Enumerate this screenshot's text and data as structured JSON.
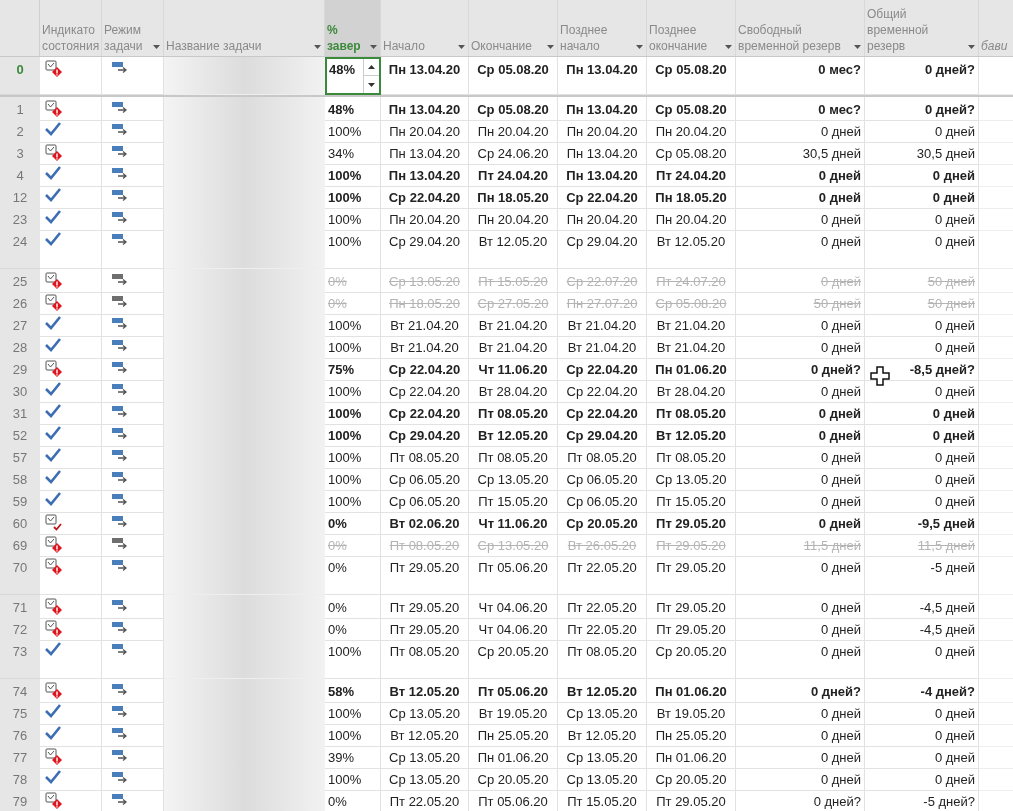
{
  "columns": [
    {
      "lines": [
        "Индикато",
        "состояния"
      ],
      "filter": false,
      "selected": false,
      "italic": false
    },
    {
      "lines": [
        "Режим",
        "задачи"
      ],
      "filter": true,
      "selected": false,
      "italic": false
    },
    {
      "lines": [
        "Название задачи"
      ],
      "filter": true,
      "selected": false,
      "italic": false
    },
    {
      "lines": [
        "%",
        "завер"
      ],
      "filter": true,
      "selected": true,
      "italic": false
    },
    {
      "lines": [
        "Начало"
      ],
      "filter": true,
      "selected": false,
      "italic": false
    },
    {
      "lines": [
        "Окончание"
      ],
      "filter": true,
      "selected": false,
      "italic": false
    },
    {
      "lines": [
        "Позднее",
        "начало"
      ],
      "filter": true,
      "selected": false,
      "italic": false
    },
    {
      "lines": [
        "Позднее",
        "окончание"
      ],
      "filter": true,
      "selected": false,
      "italic": false
    },
    {
      "lines": [
        "Свободный",
        "временной резерв"
      ],
      "filter": true,
      "selected": false,
      "italic": false
    },
    {
      "lines": [
        "Общий",
        "временной",
        "резерв"
      ],
      "filter": true,
      "selected": false,
      "italic": false
    },
    {
      "lines": [
        "бави"
      ],
      "filter": false,
      "selected": false,
      "italic": true
    }
  ],
  "rows": [
    {
      "id": "0",
      "kind": "alert",
      "bold": true,
      "inactive": false,
      "tall": true,
      "selected": true,
      "values": [
        "48%",
        "Пн 13.04.20",
        "Ср 05.08.20",
        "Пн 13.04.20",
        "Ср 05.08.20",
        "0 мес?",
        "0 дней?"
      ]
    },
    {
      "id": "1",
      "kind": "alert",
      "bold": true,
      "inactive": false,
      "tall": false,
      "selected": false,
      "values": [
        "48%",
        "Пн 13.04.20",
        "Ср 05.08.20",
        "Пн 13.04.20",
        "Ср 05.08.20",
        "0 мес?",
        "0 дней?"
      ]
    },
    {
      "id": "2",
      "kind": "done",
      "bold": false,
      "inactive": false,
      "tall": false,
      "selected": false,
      "values": [
        "100%",
        "Пн 20.04.20",
        "Пн 20.04.20",
        "Пн 20.04.20",
        "Пн 20.04.20",
        "0 дней",
        "0 дней"
      ]
    },
    {
      "id": "3",
      "kind": "alert",
      "bold": false,
      "inactive": false,
      "tall": false,
      "selected": false,
      "values": [
        "34%",
        "Пн 13.04.20",
        "Ср 24.06.20",
        "Пн 13.04.20",
        "Ср 05.08.20",
        "30,5 дней",
        "30,5 дней"
      ]
    },
    {
      "id": "4",
      "kind": "done",
      "bold": true,
      "inactive": false,
      "tall": false,
      "selected": false,
      "values": [
        "100%",
        "Пн 13.04.20",
        "Пт 24.04.20",
        "Пн 13.04.20",
        "Пт 24.04.20",
        "0 дней",
        "0 дней"
      ]
    },
    {
      "id": "12",
      "kind": "done",
      "bold": true,
      "inactive": false,
      "tall": false,
      "selected": false,
      "values": [
        "100%",
        "Ср 22.04.20",
        "Пн 18.05.20",
        "Ср 22.04.20",
        "Пн 18.05.20",
        "0 дней",
        "0 дней"
      ]
    },
    {
      "id": "23",
      "kind": "done",
      "bold": false,
      "inactive": false,
      "tall": false,
      "selected": false,
      "values": [
        "100%",
        "Пн 20.04.20",
        "Пн 20.04.20",
        "Пн 20.04.20",
        "Пн 20.04.20",
        "0 дней",
        "0 дней"
      ]
    },
    {
      "id": "24",
      "kind": "done",
      "bold": false,
      "inactive": false,
      "tall": true,
      "selected": false,
      "values": [
        "100%",
        "Ср 29.04.20",
        "Вт 12.05.20",
        "Ср 29.04.20",
        "Вт 12.05.20",
        "0 дней",
        "0 дней"
      ]
    },
    {
      "id": "25",
      "kind": "alert",
      "bold": false,
      "inactive": true,
      "tall": false,
      "selected": false,
      "values": [
        "0%",
        "Ср 13.05.20",
        "Пт 15.05.20",
        "Ср 22.07.20",
        "Пт 24.07.20",
        "0 дней",
        "50 дней"
      ]
    },
    {
      "id": "26",
      "kind": "alert",
      "bold": false,
      "inactive": true,
      "tall": false,
      "selected": false,
      "values": [
        "0%",
        "Пн 18.05.20",
        "Ср 27.05.20",
        "Пн 27.07.20",
        "Ср 05.08.20",
        "50 дней",
        "50 дней"
      ]
    },
    {
      "id": "27",
      "kind": "done",
      "bold": false,
      "inactive": false,
      "tall": false,
      "selected": false,
      "values": [
        "100%",
        "Вт 21.04.20",
        "Вт 21.04.20",
        "Вт 21.04.20",
        "Вт 21.04.20",
        "0 дней",
        "0 дней"
      ]
    },
    {
      "id": "28",
      "kind": "done",
      "bold": false,
      "inactive": false,
      "tall": false,
      "selected": false,
      "values": [
        "100%",
        "Вт 21.04.20",
        "Вт 21.04.20",
        "Вт 21.04.20",
        "Вт 21.04.20",
        "0 дней",
        "0 дней"
      ]
    },
    {
      "id": "29",
      "kind": "alert",
      "bold": true,
      "inactive": false,
      "tall": false,
      "selected": false,
      "values": [
        "75%",
        "Ср 22.04.20",
        "Чт 11.06.20",
        "Ср 22.04.20",
        "Пн 01.06.20",
        "0 дней?",
        "-8,5 дней?"
      ]
    },
    {
      "id": "30",
      "kind": "done",
      "bold": false,
      "inactive": false,
      "tall": false,
      "selected": false,
      "values": [
        "100%",
        "Ср 22.04.20",
        "Вт 28.04.20",
        "Ср 22.04.20",
        "Вт 28.04.20",
        "0 дней",
        "0 дней"
      ]
    },
    {
      "id": "31",
      "kind": "done",
      "bold": true,
      "inactive": false,
      "tall": false,
      "selected": false,
      "values": [
        "100%",
        "Ср 22.04.20",
        "Пт 08.05.20",
        "Ср 22.04.20",
        "Пт 08.05.20",
        "0 дней",
        "0 дней"
      ]
    },
    {
      "id": "52",
      "kind": "done",
      "bold": true,
      "inactive": false,
      "tall": false,
      "selected": false,
      "values": [
        "100%",
        "Ср 29.04.20",
        "Вт 12.05.20",
        "Ср 29.04.20",
        "Вт 12.05.20",
        "0 дней",
        "0 дней"
      ]
    },
    {
      "id": "57",
      "kind": "done",
      "bold": false,
      "inactive": false,
      "tall": false,
      "selected": false,
      "values": [
        "100%",
        "Пт 08.05.20",
        "Пт 08.05.20",
        "Пт 08.05.20",
        "Пт 08.05.20",
        "0 дней",
        "0 дней"
      ]
    },
    {
      "id": "58",
      "kind": "done",
      "bold": false,
      "inactive": false,
      "tall": false,
      "selected": false,
      "values": [
        "100%",
        "Ср 06.05.20",
        "Ср 13.05.20",
        "Ср 06.05.20",
        "Ср 13.05.20",
        "0 дней",
        "0 дней"
      ]
    },
    {
      "id": "59",
      "kind": "done",
      "bold": false,
      "inactive": false,
      "tall": false,
      "selected": false,
      "values": [
        "100%",
        "Ср 06.05.20",
        "Пт 15.05.20",
        "Ср 06.05.20",
        "Пт 15.05.20",
        "0 дней",
        "0 дней"
      ]
    },
    {
      "id": "60",
      "kind": "ontime",
      "bold": true,
      "inactive": false,
      "tall": false,
      "selected": false,
      "values": [
        "0%",
        "Вт 02.06.20",
        "Чт 11.06.20",
        "Ср 20.05.20",
        "Пт 29.05.20",
        "0 дней",
        "-9,5 дней"
      ]
    },
    {
      "id": "69",
      "kind": "alert",
      "bold": false,
      "inactive": true,
      "tall": false,
      "selected": false,
      "values": [
        "0%",
        "Пт 08.05.20",
        "Ср 13.05.20",
        "Вт 26.05.20",
        "Пт 29.05.20",
        "11,5 дней",
        "11,5 дней"
      ]
    },
    {
      "id": "70",
      "kind": "alert",
      "bold": false,
      "inactive": false,
      "tall": true,
      "selected": false,
      "values": [
        "0%",
        "Пт 29.05.20",
        "Пт 05.06.20",
        "Пт 22.05.20",
        "Пт 29.05.20",
        "0 дней",
        "-5 дней"
      ]
    },
    {
      "id": "71",
      "kind": "alert",
      "bold": false,
      "inactive": false,
      "tall": false,
      "selected": false,
      "values": [
        "0%",
        "Пт 29.05.20",
        "Чт 04.06.20",
        "Пт 22.05.20",
        "Пт 29.05.20",
        "0 дней",
        "-4,5 дней"
      ]
    },
    {
      "id": "72",
      "kind": "alert",
      "bold": false,
      "inactive": false,
      "tall": false,
      "selected": false,
      "values": [
        "0%",
        "Пт 29.05.20",
        "Чт 04.06.20",
        "Пт 22.05.20",
        "Пт 29.05.20",
        "0 дней",
        "-4,5 дней"
      ]
    },
    {
      "id": "73",
      "kind": "done",
      "bold": false,
      "inactive": false,
      "tall": true,
      "selected": false,
      "values": [
        "100%",
        "Пт 08.05.20",
        "Ср 20.05.20",
        "Пт 08.05.20",
        "Ср 20.05.20",
        "0 дней",
        "0 дней"
      ]
    },
    {
      "id": "74",
      "kind": "alert",
      "bold": true,
      "inactive": false,
      "tall": false,
      "selected": false,
      "values": [
        "58%",
        "Вт 12.05.20",
        "Пт 05.06.20",
        "Вт 12.05.20",
        "Пн 01.06.20",
        "0 дней?",
        "-4 дней?"
      ]
    },
    {
      "id": "75",
      "kind": "done",
      "bold": false,
      "inactive": false,
      "tall": false,
      "selected": false,
      "values": [
        "100%",
        "Ср 13.05.20",
        "Вт 19.05.20",
        "Ср 13.05.20",
        "Вт 19.05.20",
        "0 дней",
        "0 дней"
      ]
    },
    {
      "id": "76",
      "kind": "done",
      "bold": false,
      "inactive": false,
      "tall": false,
      "selected": false,
      "values": [
        "100%",
        "Вт 12.05.20",
        "Пн 25.05.20",
        "Вт 12.05.20",
        "Пн 25.05.20",
        "0 дней",
        "0 дней"
      ]
    },
    {
      "id": "77",
      "kind": "alert",
      "bold": false,
      "inactive": false,
      "tall": false,
      "selected": false,
      "values": [
        "39%",
        "Ср 13.05.20",
        "Пн 01.06.20",
        "Ср 13.05.20",
        "Пн 01.06.20",
        "0 дней",
        "0 дней"
      ]
    },
    {
      "id": "78",
      "kind": "done",
      "bold": false,
      "inactive": false,
      "tall": false,
      "selected": false,
      "values": [
        "100%",
        "Ср 13.05.20",
        "Ср 20.05.20",
        "Ср 13.05.20",
        "Ср 20.05.20",
        "0 дней",
        "0 дней"
      ]
    },
    {
      "id": "79",
      "kind": "alert",
      "bold": false,
      "inactive": false,
      "tall": false,
      "selected": false,
      "values": [
        "0%",
        "Пт 22.05.20",
        "Пт 05.06.20",
        "Пт 15.05.20",
        "Пт 29.05.20",
        "0 дней?",
        "-5 дней?"
      ]
    }
  ]
}
